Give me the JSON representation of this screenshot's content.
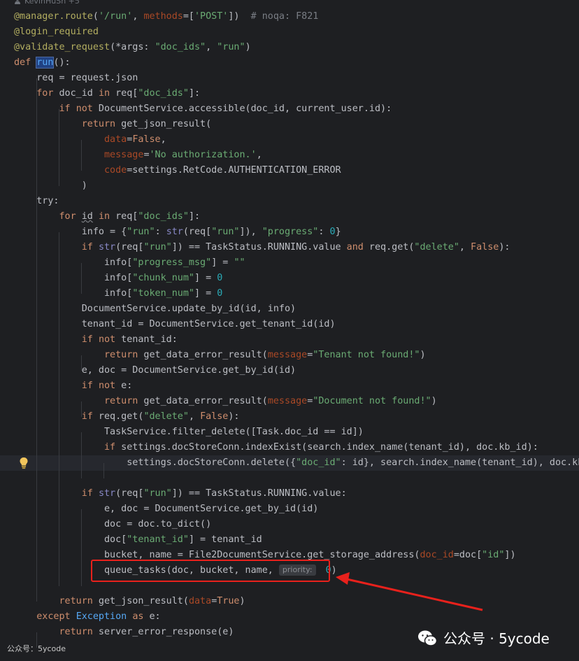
{
  "blame": {
    "author": "KevinHuSh +5"
  },
  "code_lines": [
    "@manager.route('/run', methods=['POST'])  # noqa: F821",
    "@login_required",
    "@validate_request(*args: \"doc_ids\", \"run\")",
    "def run():",
    "    req = request.json",
    "    for doc_id in req[\"doc_ids\"]:",
    "        if not DocumentService.accessible(doc_id, current_user.id):",
    "            return get_json_result(",
    "                data=False,",
    "                message='No authorization.',",
    "                code=settings.RetCode.AUTHENTICATION_ERROR",
    "            )",
    "    try:",
    "        for id in req[\"doc_ids\"]:",
    "            info = {\"run\": str(req[\"run\"]), \"progress\": 0}",
    "            if str(req[\"run\"]) == TaskStatus.RUNNING.value and req.get(\"delete\", False):",
    "                info[\"progress_msg\"] = \"\"",
    "                info[\"chunk_num\"] = 0",
    "                info[\"token_num\"] = 0",
    "            DocumentService.update_by_id(id, info)",
    "            tenant_id = DocumentService.get_tenant_id(id)",
    "            if not tenant_id:",
    "                return get_data_error_result(message=\"Tenant not found!\")",
    "            e, doc = DocumentService.get_by_id(id)",
    "            if not e:",
    "                return get_data_error_result(message=\"Document not found!\")",
    "            if req.get(\"delete\", False):",
    "                TaskService.filter_delete([Task.doc_id == id])",
    "                if settings.docStoreConn.indexExist(search.index_name(tenant_id), doc.kb_id):",
    "                    settings.docStoreConn.delete({\"doc_id\": id}, search.index_name(tenant_id), doc.kb",
    "",
    "            if str(req[\"run\"]) == TaskStatus.RUNNING.value:",
    "                e, doc = DocumentService.get_by_id(id)",
    "                doc = doc.to_dict()",
    "                doc[\"tenant_id\"] = tenant_id",
    "                bucket, name = File2DocumentService.get_storage_address(doc_id=doc[\"id\"])",
    "                queue_tasks(doc, bucket, name, priority: 0)",
    "",
    "        return get_json_result(data=True)",
    "    except Exception as e:",
    "        return server_error_response(e)"
  ],
  "inlay_hints": {
    "args": "*args:",
    "priority": "priority:"
  },
  "watermark": {
    "text": "公众号 · 5ycode",
    "small": "公众号：5ycode"
  },
  "colors": {
    "background": "#1e1f22",
    "keyword": "#cf8e6d",
    "decorator": "#b3ae60",
    "string": "#6aab73",
    "number": "#2aacb8",
    "named_param": "#aa4926",
    "comment": "#7a7e85",
    "highlight_box": "#e8211c"
  },
  "icons": [
    "person-icon",
    "lightbulb-icon",
    "wechat-icon",
    "arrow"
  ]
}
